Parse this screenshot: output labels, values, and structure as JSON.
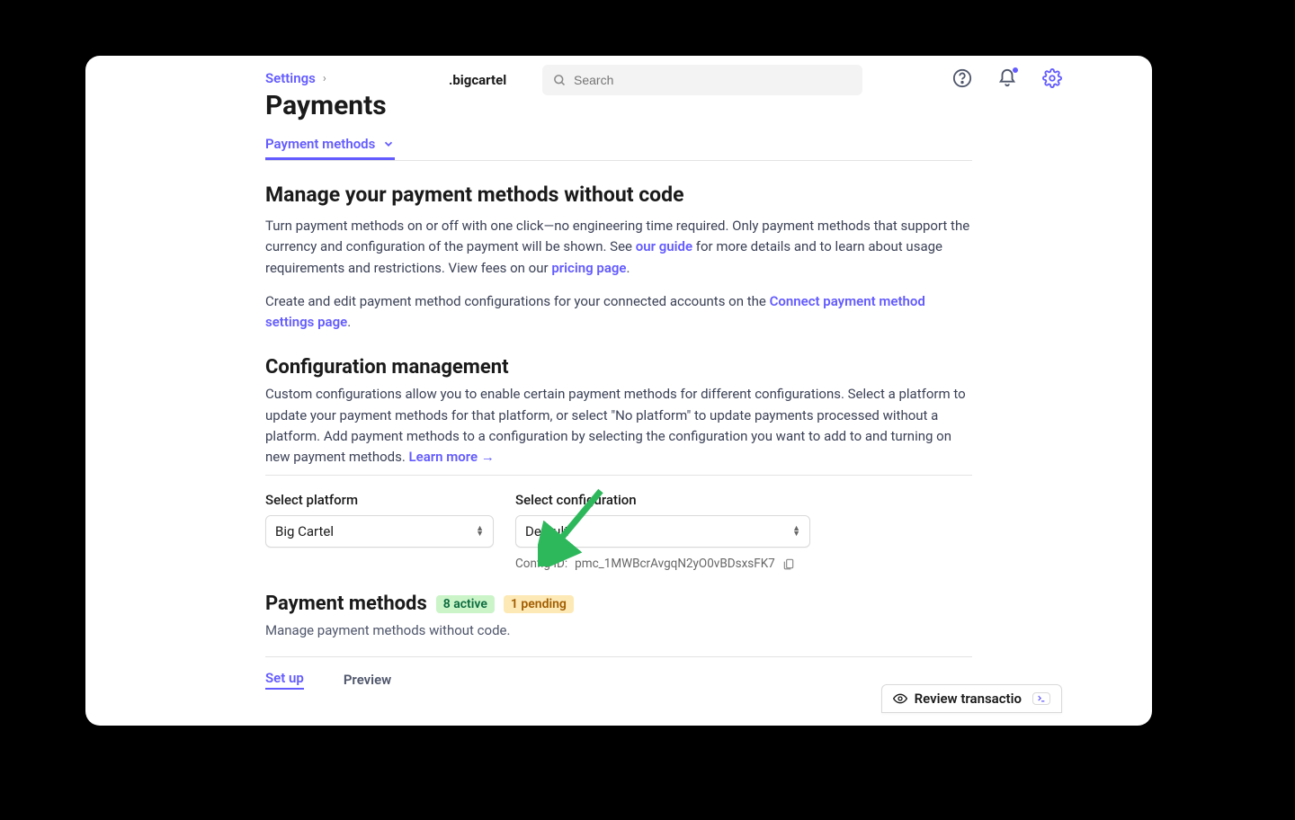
{
  "header": {
    "brand": ".bigcartel",
    "search_placeholder": "Search"
  },
  "breadcrumb": {
    "parent": "Settings"
  },
  "page": {
    "title": "Payments"
  },
  "tabs": {
    "active": "Payment methods"
  },
  "section1": {
    "heading": "Manage your payment methods without code",
    "p1a": "Turn payment methods on or off with one click—no engineering time required. Only payment methods that support the currency and configuration of the payment will be shown. See ",
    "p1link1": "our guide",
    "p1b": " for more details and to learn about usage requirements and restrictions. View fees on our ",
    "p1link2": "pricing page",
    "p1c": ".",
    "p2a": "Create and edit payment method configurations for your connected accounts on the ",
    "p2link": "Connect payment method settings page",
    "p2b": "."
  },
  "section2": {
    "heading": "Configuration management",
    "bodya": "Custom configurations allow you to enable certain payment methods for different configurations. Select a platform to update your payment methods for that platform, or select \"No platform\" to update payments processed without a platform. Add payment methods to a configuration by selecting the configuration you want to add to and turning on new payment methods. ",
    "learn": "Learn more →"
  },
  "selects": {
    "platform_label": "Select platform",
    "platform_value": "Big Cartel",
    "config_label": "Select configuration",
    "config_value": "Default",
    "config_id_label": "Config ID: ",
    "config_id": "pmc_1MWBcrAvgqN2yO0vBDsxsFK7"
  },
  "pm": {
    "heading": "Payment methods",
    "badge_active": "8 active",
    "badge_pending": "1 pending",
    "sub": "Manage payment methods without code."
  },
  "bottom": {
    "tab1": "Set up",
    "tab2": "Preview",
    "review": "Review transactio"
  }
}
